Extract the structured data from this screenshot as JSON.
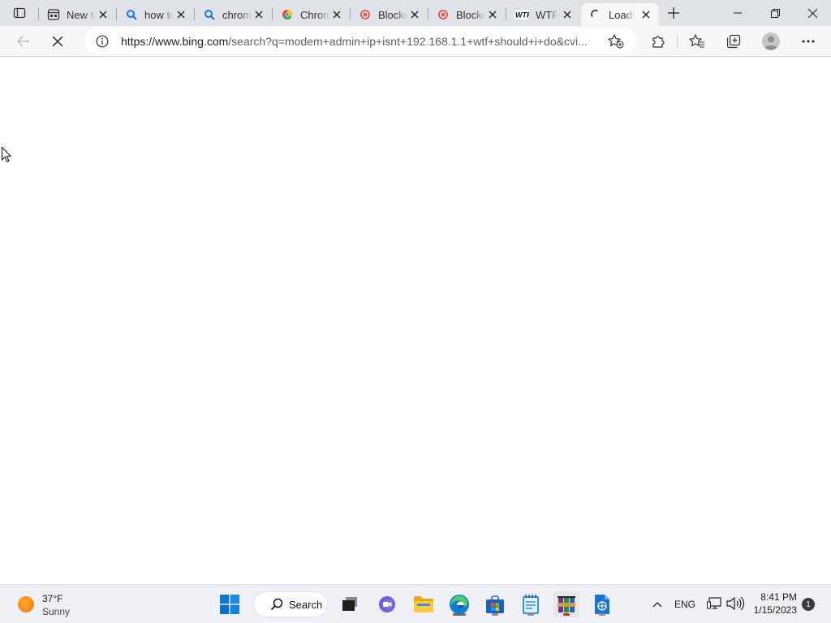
{
  "window": {
    "tabs": [
      {
        "title": "New tab",
        "icon": "new-tab-page-icon"
      },
      {
        "title": "how to",
        "icon": "bing-search-icon"
      },
      {
        "title": "chrome",
        "icon": "bing-search-icon"
      },
      {
        "title": "Chrome",
        "icon": "chrome-icon"
      },
      {
        "title": "Blocked",
        "icon": "shield-icon"
      },
      {
        "title": "Blocked",
        "icon": "shield-icon"
      },
      {
        "title": "WTF",
        "icon": "wtf-icon"
      },
      {
        "title": "Loading",
        "icon": "loading-spinner-icon",
        "active": true
      }
    ],
    "controls": {
      "minimize": "minimize-icon",
      "restore": "restore-icon",
      "close": "close-icon"
    }
  },
  "toolbar": {
    "url_host": "https://www.bing.com",
    "url_rest": "/search?q=modem+admin+ip+isnt+192.168.1.1+wtf+should+i+do&cvi..."
  },
  "taskbar": {
    "weather": {
      "temp": "37°F",
      "condition": "Sunny"
    },
    "search_label": "Search",
    "language": "ENG",
    "time": "8:41 PM",
    "date": "1/15/2023",
    "notifications": "1"
  },
  "colors": {
    "tabstrip_bg": "#dfe3e8",
    "toolbar_bg": "#f7f7f7",
    "taskbar_bg": "#eef0f5",
    "accent": "#0078d4"
  }
}
